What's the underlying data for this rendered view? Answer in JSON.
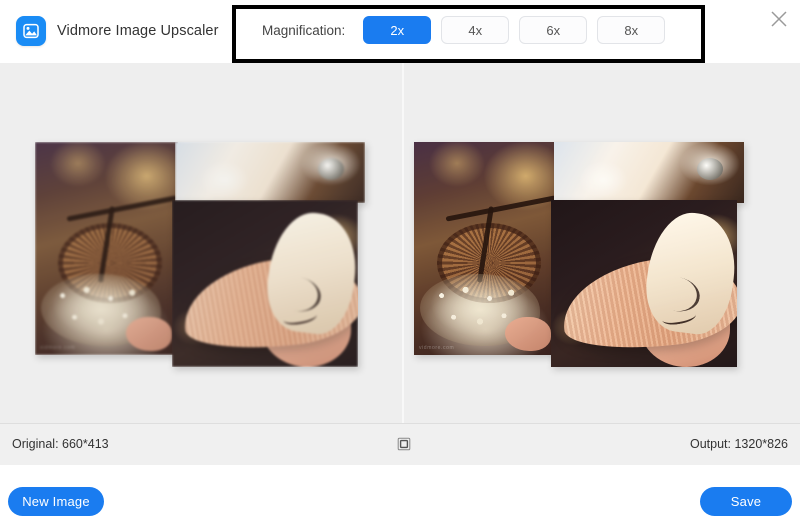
{
  "app": {
    "title": "Vidmore Image Upscaler",
    "logo_icon": "image-upscaler-logo-icon",
    "accent_color": "#1a7cf0",
    "header_bg": "#ffffff",
    "canvas_bg": "#eeeeee",
    "statusbar_bg": "#f0f0f0",
    "highlight_color": "#000000"
  },
  "header": {
    "close_icon": "close-icon",
    "magnification": {
      "label": "Magnification:",
      "selected": "2x",
      "options": [
        {
          "label": "2x",
          "selected": true
        },
        {
          "label": "4x",
          "selected": false
        },
        {
          "label": "6x",
          "selected": false
        },
        {
          "label": "8x",
          "selected": false
        }
      ]
    }
  },
  "preview": {
    "left": {
      "name": "original-preview",
      "alt": "Photo collage of a bicycle with white flowers and a woman wearing a wide sun hat (original, blurry)"
    },
    "right": {
      "name": "upscaled-preview",
      "alt": "Photo collage of a bicycle with white flowers and a woman wearing a wide sun hat (upscaled, sharp)"
    },
    "watermark": "vidmore.com"
  },
  "status": {
    "original_label": "Original: 660*413",
    "output_label": "Output: 1320*826",
    "compare_icon": "compare-square-icon"
  },
  "footer": {
    "new_image_label": "New Image",
    "save_label": "Save"
  }
}
